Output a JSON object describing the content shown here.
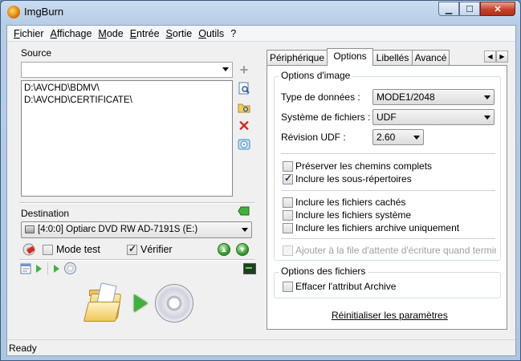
{
  "window": {
    "title": "ImgBurn",
    "icons": {
      "app": "imgburn-flame-icon",
      "minimize": "minimize-icon",
      "maximize": "maximize-icon",
      "close": "close-icon"
    }
  },
  "menu": [
    "Fichier",
    "Affichage",
    "Mode",
    "Entrée",
    "Sortie",
    "Outils",
    "?"
  ],
  "source": {
    "label": "Source",
    "combo_value": "",
    "items": [
      "D:\\AVCHD\\BDMV\\",
      "D:\\AVCHD\\CERTIFICATE\\"
    ]
  },
  "destination": {
    "label": "Destination",
    "drive": "[4:0:0] Optiarc DVD RW AD-7191S (E:)",
    "test_mode": {
      "label": "Mode test",
      "checked": false
    },
    "verify": {
      "label": "Vérifier",
      "checked": true
    }
  },
  "tabs": [
    "Périphérique",
    "Options",
    "Libellés",
    "Avancé"
  ],
  "active_tab": "Options",
  "image_options": {
    "legend": "Options d'image",
    "data_type": {
      "label": "Type de données :",
      "value": "MODE1/2048"
    },
    "filesystem": {
      "label": "Système de fichiers :",
      "value": "UDF"
    },
    "udf_revision": {
      "label": "Révision UDF :",
      "value": "2.60"
    },
    "checks": [
      {
        "label": "Préserver les chemins complets",
        "checked": false
      },
      {
        "label": "Inclure les sous-répertoires",
        "checked": true
      },
      {
        "label": "Inclure les fichiers cachés",
        "checked": false
      },
      {
        "label": "Inclure les fichiers système",
        "checked": false
      },
      {
        "label": "Inclure les fichiers archive uniquement",
        "checked": false
      }
    ],
    "queue": {
      "label": "Ajouter à la file d'attente d'écriture quand termin",
      "checked": false,
      "enabled": false
    }
  },
  "file_options": {
    "legend": "Options des fichiers",
    "clear_archive": {
      "label": "Effacer l'attribut Archive",
      "checked": false
    }
  },
  "reset_link": "Réinitialiser les paramètres",
  "status": "Ready",
  "colors": {
    "accent_green": "#3fb23a",
    "remove_red": "#d42a1c",
    "title_gradient": "#b7cde6"
  }
}
